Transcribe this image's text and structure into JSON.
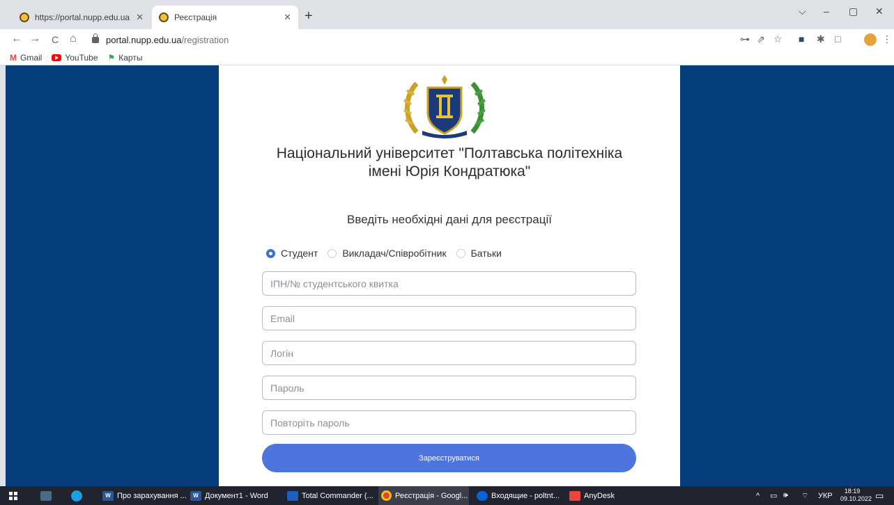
{
  "browser": {
    "tabs": [
      {
        "title": "https://portal.nupp.edu.ua",
        "active": false
      },
      {
        "title": "Реєстрація",
        "active": true
      }
    ],
    "new_tab": "+",
    "controls": {
      "tab_search": "⌵",
      "minimize": "–",
      "maximize": "▢",
      "close": "✕"
    },
    "nav": {
      "back": "←",
      "forward": "→",
      "reload": "C",
      "home": "⌂"
    },
    "url": {
      "host": "portal.nupp.edu.ua",
      "path": "/registration"
    },
    "toolbar_icons": {
      "key": "⊶",
      "share": "⇗",
      "bookmark": "☆",
      "ext": "■",
      "puzzle": "✱",
      "sidepanel": "□",
      "menu": "⋮"
    },
    "bookmarks": [
      {
        "label": "Gmail",
        "icon": "gmail-icon"
      },
      {
        "label": "YouTube",
        "icon": "youtube-icon"
      },
      {
        "label": "Карты",
        "icon": "maps-icon"
      }
    ]
  },
  "page": {
    "university_line1": "Національний університет \"Полтавська політехніка",
    "university_line2": "імені Юрія Кондратюка\"",
    "subtitle": "Введіть необхідні дані для реєстрації",
    "roles": [
      {
        "label": "Студент",
        "checked": true
      },
      {
        "label": "Викладач/Співробітник",
        "checked": false
      },
      {
        "label": "Батьки",
        "checked": false
      }
    ],
    "fields": {
      "id_placeholder": "ІПН/№ студентського квитка",
      "email_placeholder": "Email",
      "login_placeholder": "Логін",
      "password_placeholder": "Пароль",
      "repeat_placeholder": "Повторіть пароль"
    },
    "submit_label": "Зареєструватися",
    "colors": {
      "background": "#053e7c",
      "accent": "#4e74de",
      "radio": "#3b6fd8"
    }
  },
  "taskbar": {
    "apps": [
      {
        "label": "Про зарахування ...",
        "icon": "word-icon"
      },
      {
        "label": "Документ1 - Word",
        "icon": "word-icon"
      },
      {
        "label": "Total Commander (...",
        "icon": "total-commander-icon"
      },
      {
        "label": "Реєстрація - Googl...",
        "icon": "chrome-icon",
        "active": true
      },
      {
        "label": "Входящие - poltnt...",
        "icon": "mail-icon"
      },
      {
        "label": "AnyDesk",
        "icon": "anydesk-icon"
      }
    ],
    "tray": {
      "chevron": "^",
      "volume": "🕪",
      "wifi": "⌔",
      "language": "УКР",
      "notifications": "▭"
    },
    "time": "18:19",
    "date": "09.10.2022"
  }
}
